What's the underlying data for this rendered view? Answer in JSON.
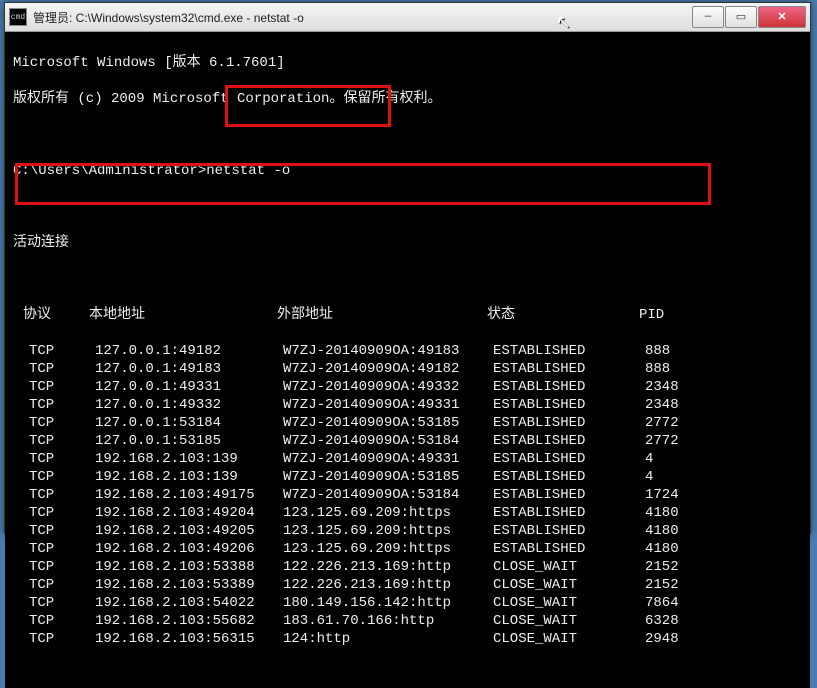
{
  "window_title": "管理员: C:\\Windows\\system32\\cmd.exe - netstat  -o",
  "icon_label": "cmd",
  "os_line": "Microsoft Windows [版本 6.1.7601]",
  "copyright_line": "版权所有 (c) 2009 Microsoft Corporation。保留所有权利。",
  "prompt": "C:\\Users\\Administrator>",
  "command": "netstat -o",
  "active_conn_label": "活动连接",
  "headers": {
    "proto": "协议",
    "local": "本地地址",
    "foreign": "外部地址",
    "state": "状态",
    "pid": "PID"
  },
  "rows": [
    {
      "proto": "TCP",
      "local": "127.0.0.1:49182",
      "foreign": "W7ZJ-20140909OA:49183",
      "state": "ESTABLISHED",
      "pid": "888"
    },
    {
      "proto": "TCP",
      "local": "127.0.0.1:49183",
      "foreign": "W7ZJ-20140909OA:49182",
      "state": "ESTABLISHED",
      "pid": "888"
    },
    {
      "proto": "TCP",
      "local": "127.0.0.1:49331",
      "foreign": "W7ZJ-20140909OA:49332",
      "state": "ESTABLISHED",
      "pid": "2348"
    },
    {
      "proto": "TCP",
      "local": "127.0.0.1:49332",
      "foreign": "W7ZJ-20140909OA:49331",
      "state": "ESTABLISHED",
      "pid": "2348"
    },
    {
      "proto": "TCP",
      "local": "127.0.0.1:53184",
      "foreign": "W7ZJ-20140909OA:53185",
      "state": "ESTABLISHED",
      "pid": "2772"
    },
    {
      "proto": "TCP",
      "local": "127.0.0.1:53185",
      "foreign": "W7ZJ-20140909OA:53184",
      "state": "ESTABLISHED",
      "pid": "2772"
    },
    {
      "proto": "TCP",
      "local": "192.168.2.103:139",
      "foreign": "W7ZJ-20140909OA:49331",
      "state": "ESTABLISHED",
      "pid": "4"
    },
    {
      "proto": "TCP",
      "local": "192.168.2.103:139",
      "foreign": "W7ZJ-20140909OA:53185",
      "state": "ESTABLISHED",
      "pid": "4"
    },
    {
      "proto": "TCP",
      "local": "192.168.2.103:49175",
      "foreign": "W7ZJ-20140909OA:53184",
      "state": "ESTABLISHED",
      "pid": "1724"
    },
    {
      "proto": "TCP",
      "local": "192.168.2.103:49204",
      "foreign": "123.125.69.209:https",
      "state": "ESTABLISHED",
      "pid": "4180"
    },
    {
      "proto": "TCP",
      "local": "192.168.2.103:49205",
      "foreign": "123.125.69.209:https",
      "state": "ESTABLISHED",
      "pid": "4180"
    },
    {
      "proto": "TCP",
      "local": "192.168.2.103:49206",
      "foreign": "123.125.69.209:https",
      "state": "ESTABLISHED",
      "pid": "4180"
    },
    {
      "proto": "TCP",
      "local": "192.168.2.103:53388",
      "foreign": "122.226.213.169:http",
      "state": "CLOSE_WAIT",
      "pid": "2152"
    },
    {
      "proto": "TCP",
      "local": "192.168.2.103:53389",
      "foreign": "122.226.213.169:http",
      "state": "CLOSE_WAIT",
      "pid": "2152"
    },
    {
      "proto": "TCP",
      "local": "192.168.2.103:54022",
      "foreign": "180.149.156.142:http",
      "state": "CLOSE_WAIT",
      "pid": "7864"
    },
    {
      "proto": "TCP",
      "local": "192.168.2.103:55682",
      "foreign": "183.61.70.166:http",
      "state": "CLOSE_WAIT",
      "pid": "6328"
    },
    {
      "proto": "TCP",
      "local": "192.168.2.103:56315",
      "foreign": "124:http",
      "state": "CLOSE_WAIT",
      "pid": "2948"
    }
  ],
  "win_controls": {
    "min": "—",
    "max": "▭",
    "close": "✕"
  }
}
